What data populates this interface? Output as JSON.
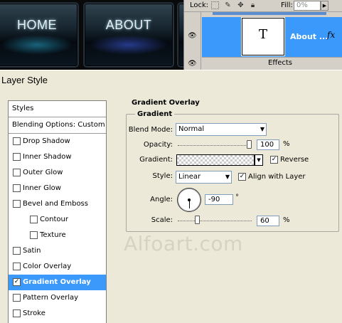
{
  "canvas": {
    "buttons": [
      "HOME",
      "ABOUT"
    ]
  },
  "layers_panel": {
    "lock_label": "Lock:",
    "fill_label": "Fill:",
    "fill_value": "0%",
    "thumbnail_glyph": "T",
    "layer_name": "About ...",
    "fx_label": "fx",
    "effects_label": "Effects"
  },
  "dialog": {
    "title": "Layer Style",
    "styles_header": "Styles",
    "blending_options": "Blending Options: Custom",
    "style_items": [
      {
        "label": "Drop Shadow",
        "checked": false,
        "sub": false,
        "selected": false
      },
      {
        "label": "Inner Shadow",
        "checked": false,
        "sub": false,
        "selected": false
      },
      {
        "label": "Outer Glow",
        "checked": false,
        "sub": false,
        "selected": false
      },
      {
        "label": "Inner Glow",
        "checked": false,
        "sub": false,
        "selected": false
      },
      {
        "label": "Bevel and Emboss",
        "checked": false,
        "sub": false,
        "selected": false
      },
      {
        "label": "Contour",
        "checked": false,
        "sub": true,
        "selected": false
      },
      {
        "label": "Texture",
        "checked": false,
        "sub": true,
        "selected": false
      },
      {
        "label": "Satin",
        "checked": false,
        "sub": false,
        "selected": false
      },
      {
        "label": "Color Overlay",
        "checked": false,
        "sub": false,
        "selected": false
      },
      {
        "label": "Gradient Overlay",
        "checked": true,
        "sub": false,
        "selected": true
      },
      {
        "label": "Pattern Overlay",
        "checked": false,
        "sub": false,
        "selected": false
      },
      {
        "label": "Stroke",
        "checked": false,
        "sub": false,
        "selected": false
      }
    ],
    "section_title": "Gradient Overlay",
    "group_title": "Gradient",
    "blend_mode_label": "Blend Mode:",
    "blend_mode_value": "Normal",
    "opacity_label": "Opacity:",
    "opacity_value": "100",
    "opacity_fraction": 1.0,
    "percent_sign": "%",
    "gradient_label": "Gradient:",
    "reverse_label": "Reverse",
    "reverse_checked": true,
    "style_label": "Style:",
    "style_value": "Linear",
    "align_label": "Align with Layer",
    "align_checked": true,
    "angle_label": "Angle:",
    "angle_value": "-90",
    "degree_sign": "°",
    "scale_label": "Scale:",
    "scale_value": "60",
    "scale_fraction": 0.25
  },
  "watermark": "Alfoart.com",
  "colors": {
    "selection_blue": "#3b99fc",
    "dialog_bg": "#ece9d8"
  }
}
